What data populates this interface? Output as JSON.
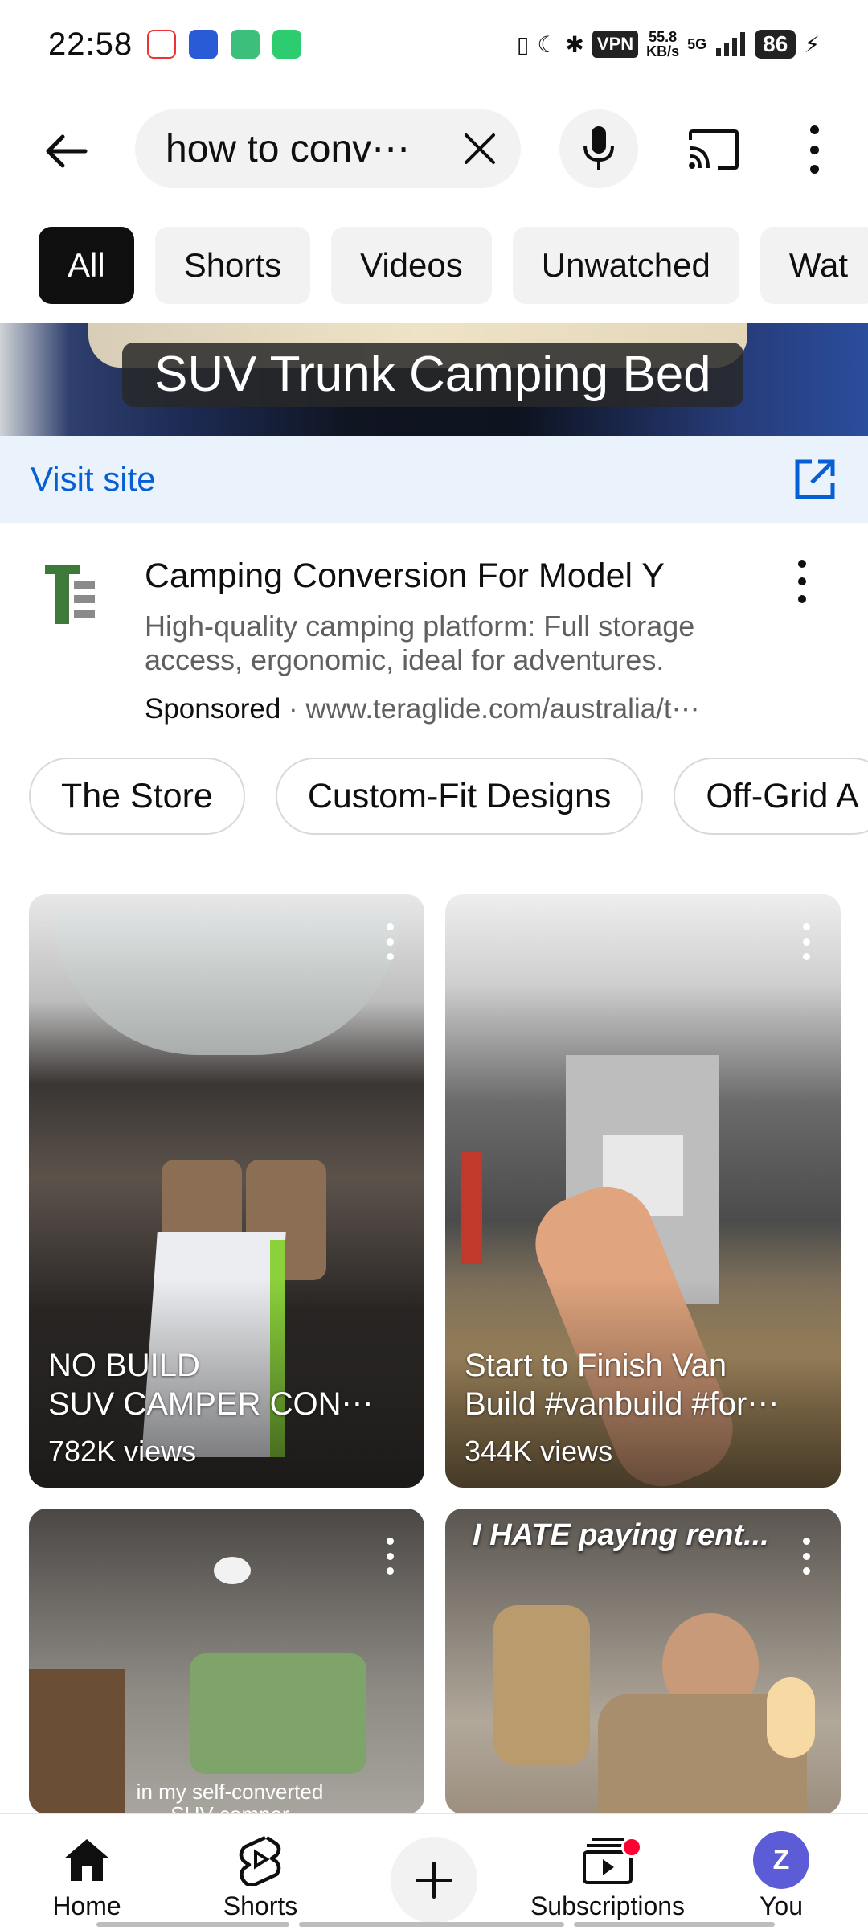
{
  "status_bar": {
    "time": "22:58",
    "vpn": "VPN",
    "speed_value": "55.8",
    "speed_unit": "KB/s",
    "network": "5G",
    "battery": "86"
  },
  "search": {
    "query": "how to conv⋯"
  },
  "filter_chips": [
    "All",
    "Shorts",
    "Videos",
    "Unwatched",
    "Wat"
  ],
  "ad": {
    "image_caption": "SUV Trunk Camping Bed",
    "visit_label": "Visit site",
    "title": "Camping Conversion For Model Y",
    "description": "High-quality camping platform: Full storage access, ergonomic, ideal for adventures.",
    "sponsored": "Sponsored",
    "separator": "·",
    "url": "www.teraglide.com/australia/t⋯",
    "sitelinks": [
      "The Store",
      "Custom-Fit Designs",
      "Off-Grid A"
    ]
  },
  "shorts": [
    {
      "title_line1": "NO BUILD",
      "title_line2": "SUV CAMPER CON⋯",
      "views": "782K views"
    },
    {
      "title_line1": "Start to Finish Van",
      "title_line2": "Build #vanbuild #for⋯",
      "views": "344K views"
    },
    {
      "overlay": "in my self-converted",
      "overlay2": "SUV camper"
    },
    {
      "overlay": "I HATE paying rent..."
    }
  ],
  "bottom_nav": {
    "home": "Home",
    "shorts": "Shorts",
    "subscriptions": "Subscriptions",
    "you": "You",
    "avatar_letter": "Z"
  },
  "colors": {
    "link_blue": "#065fd4",
    "visit_bg": "#eaf2fb",
    "chip_bg": "#f2f2f2",
    "active_chip": "#0f0f0f",
    "notification_red": "#ff0033",
    "avatar": "#5c5cd6",
    "logo_green": "#3d7a3a"
  }
}
